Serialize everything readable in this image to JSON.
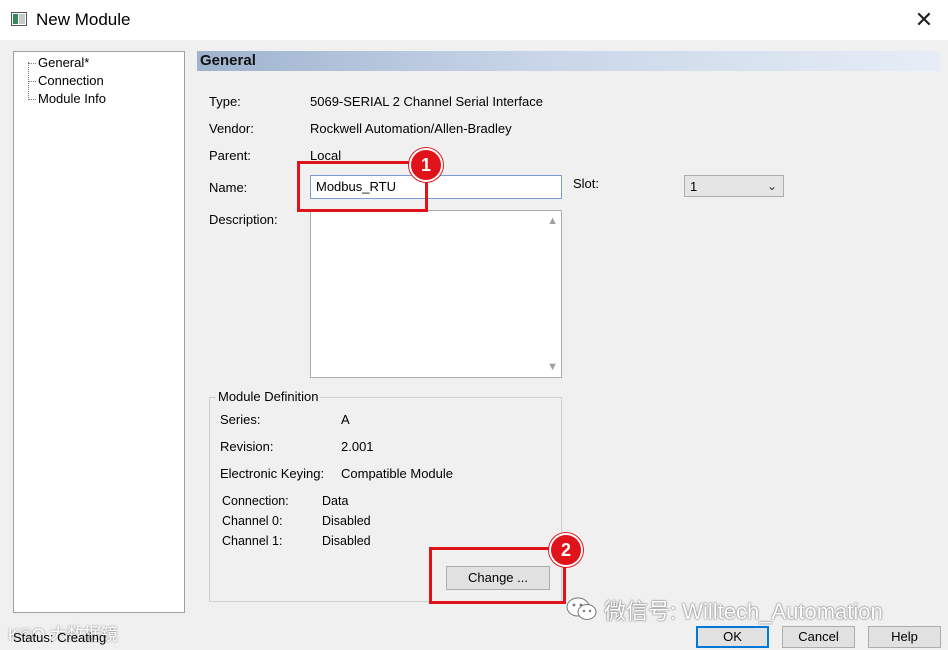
{
  "window": {
    "title": "New Module"
  },
  "tree": {
    "items": [
      "General*",
      "Connection",
      "Module Info"
    ]
  },
  "general": {
    "header": "General",
    "type_label": "Type:",
    "type_value": "5069-SERIAL 2 Channel Serial Interface",
    "vendor_label": "Vendor:",
    "vendor_value": "Rockwell Automation/Allen-Bradley",
    "parent_label": "Parent:",
    "parent_value": "Local",
    "name_label": "Name:",
    "name_value": "Modbus_RTU",
    "slot_label": "Slot:",
    "slot_value": "1",
    "description_label": "Description:",
    "description_value": ""
  },
  "module_definition": {
    "title": "Module Definition",
    "series_label": "Series:",
    "series_value": "A",
    "revision_label": "Revision:",
    "revision_value": "2.001",
    "keying_label": "Electronic Keying:",
    "keying_value": "Compatible Module",
    "connection_label": "Connection:",
    "connection_value": "Data",
    "channel0_label": "Channel 0:",
    "channel0_value": "Disabled",
    "channel1_label": "Channel 1:",
    "channel1_value": "Disabled",
    "change_button": "Change ..."
  },
  "footer": {
    "status_text": "Status: Creating",
    "ok": "OK",
    "cancel": "Cancel",
    "help": "Help"
  },
  "annotations": {
    "badge1": "1",
    "badge2": "2",
    "highlight_color": "#e0131a"
  },
  "watermarks": {
    "right": "微信号: Willtech_Automation",
    "left": "K©O 大数据镜"
  }
}
